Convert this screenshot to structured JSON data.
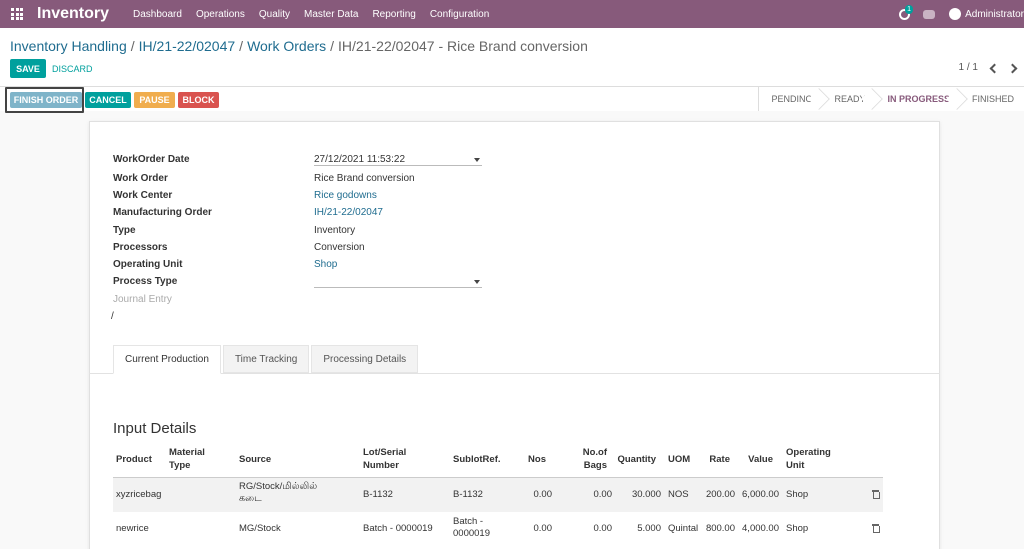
{
  "app": {
    "title": "Inventory",
    "menu": [
      "Dashboard",
      "Operations",
      "Quality",
      "Master Data",
      "Reporting",
      "Configuration"
    ],
    "activity_count": "1",
    "user_name": "Administrator"
  },
  "breadcrumb": {
    "items": [
      "Inventory Handling",
      "IH/21-22/02047",
      "Work Orders"
    ],
    "separator": "/",
    "current": "IH/21-22/02047 - Rice Brand conversion"
  },
  "actions": {
    "save": "SAVE",
    "discard": "DISCARD"
  },
  "pager": {
    "value": "1 / 1"
  },
  "statusbar": {
    "buttons": {
      "finish": "FINISH ORDER",
      "cancel": "CANCEL",
      "pause": "PAUSE",
      "block": "BLOCK"
    },
    "stages": [
      "PENDING",
      "READY",
      "IN PROGRESS",
      "FINISHED"
    ],
    "active_stage": "IN PROGRESS"
  },
  "form": {
    "workorder_date_label": "WorkOrder Date",
    "workorder_date": "27/12/2021 11:53:22",
    "work_order_label": "Work Order",
    "work_order": "Rice Brand conversion",
    "work_center_label": "Work Center",
    "work_center": "Rice godowns",
    "mo_label": "Manufacturing Order",
    "mo": "IH/21-22/02047",
    "type_label": "Type",
    "type": "Inventory",
    "processors_label": "Processors",
    "processors": "Conversion",
    "operating_unit_label": "Operating Unit",
    "operating_unit": "Shop",
    "process_type_label": "Process Type",
    "process_type": "",
    "journal_entry_label": "Journal Entry",
    "slash": "/"
  },
  "tabs": [
    "Current Production",
    "Time Tracking",
    "Processing Details"
  ],
  "input_details": {
    "title": "Input Details",
    "headers": {
      "product": "Product",
      "material_type": "Material Type",
      "source": "Source",
      "lot": "Lot/Serial Number",
      "sublot": "SublotRef.",
      "nos": "Nos",
      "bags": "No.of Bags",
      "quantity": "Quantity",
      "uom": "UOM",
      "rate": "Rate",
      "value": "Value",
      "operating_unit": "Operating Unit"
    },
    "rows": [
      {
        "product": "xyzricebag",
        "material_type": "",
        "source": "RG/Stock/மில்லில் கடை",
        "lot": "B-1132",
        "sublot": "B-1132",
        "nos": "0.00",
        "bags": "0.00",
        "quantity": "30.000",
        "uom": "NOS",
        "rate": "200.00",
        "value": "6,000.00",
        "operating_unit": "Shop"
      },
      {
        "product": "newrice",
        "material_type": "",
        "source": "MG/Stock",
        "lot": "Batch - 0000019",
        "sublot": "Batch - 0000019",
        "nos": "0.00",
        "bags": "0.00",
        "quantity": "5.000",
        "uom": "Quintal",
        "rate": "800.00",
        "value": "4,000.00",
        "operating_unit": "Shop"
      }
    ]
  }
}
